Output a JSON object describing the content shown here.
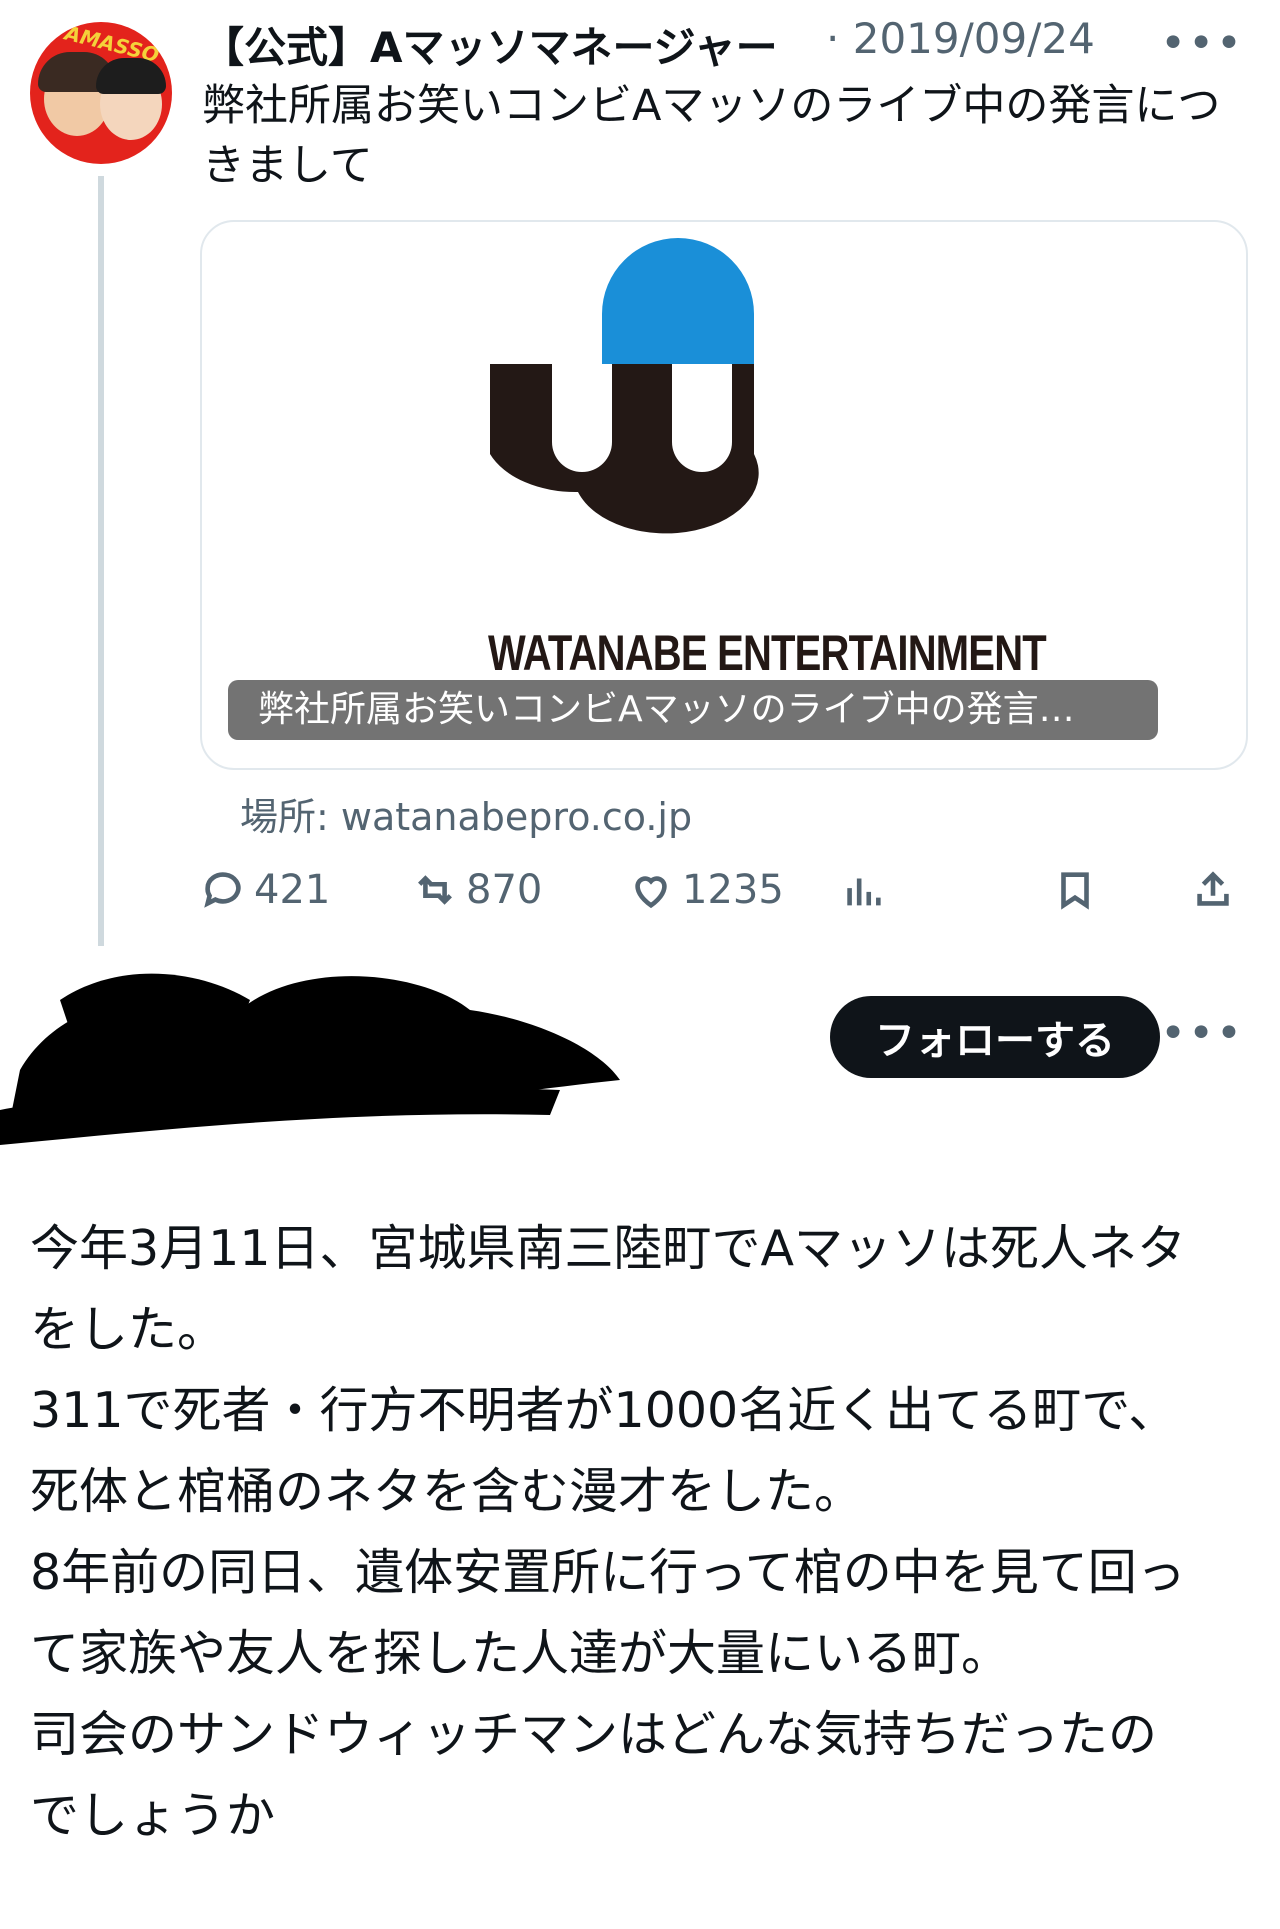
{
  "post": {
    "avatar_text": "AMASSO",
    "author": "【公式】Aマッソマネージャー",
    "separator": "·",
    "date": "2019/09/24",
    "text": "弊社所属お笑いコンビAマッソのライブ中の発言につきまして",
    "card": {
      "wordmark": "WATANABE ENTERTAINMENT",
      "caption": "弊社所属お笑いコンビAマッソのライブ中の発言…",
      "logo_colors": {
        "blue": "#1a8fd8",
        "dark": "#231815"
      }
    },
    "source": "場所: watanabepro.co.jp",
    "actions": {
      "replies": "421",
      "retweets": "870",
      "likes": "1235"
    }
  },
  "reply": {
    "follow_label": "フォローする",
    "lines": [
      "今年3月11日、宮城県南三陸町でAマッソは死人ネタ",
      "をした。",
      "311で死者・行方不明者が1000名近く出てる町で、",
      "死体と棺桶のネタを含む漫才をした。",
      "8年前の同日、遺体安置所に行って棺の中を見て回っ",
      "て家族や友人を探した人達が大量にいる町。",
      "司会のサンドウィッチマンはどんな気持ちだったの",
      "でしょうか"
    ]
  },
  "icons": [
    "reply-icon",
    "retweet-icon",
    "like-icon",
    "views-icon",
    "bookmark-icon",
    "share-icon",
    "more-icon"
  ]
}
